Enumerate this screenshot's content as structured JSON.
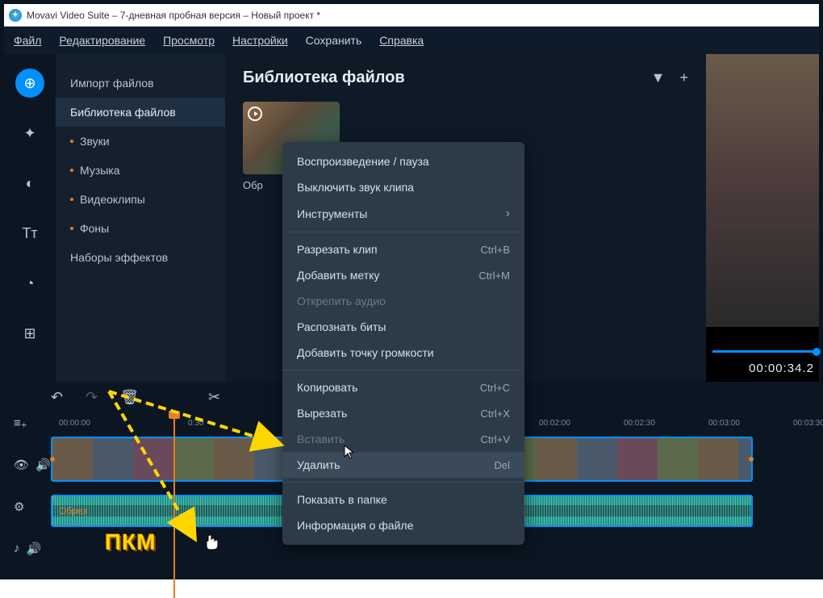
{
  "titlebar": {
    "title": "Movavi Video Suite – 7-дневная пробная версия – Новый проект *"
  },
  "menubar": [
    "Файл",
    "Редактирование",
    "Просмотр",
    "Настройки",
    "Сохранить",
    "Справка"
  ],
  "sidebar": {
    "items": [
      {
        "label": "Импорт файлов"
      },
      {
        "label": "Библиотека файлов"
      },
      {
        "label": "Звуки"
      },
      {
        "label": "Музыка"
      },
      {
        "label": "Видеоклипы"
      },
      {
        "label": "Фоны"
      },
      {
        "label": "Наборы эффектов"
      }
    ]
  },
  "content": {
    "title": "Библиотека файлов",
    "thumb_label": "Обр"
  },
  "preview": {
    "time": "00:00:34.2"
  },
  "context_menu": [
    {
      "label": "Воспроизведение / пауза",
      "shortcut": "",
      "type": "item"
    },
    {
      "label": "Выключить звук клипа",
      "shortcut": "",
      "type": "item"
    },
    {
      "label": "Инструменты",
      "shortcut": "",
      "type": "submenu"
    },
    {
      "type": "sep"
    },
    {
      "label": "Разрезать клип",
      "shortcut": "Ctrl+B",
      "type": "item"
    },
    {
      "label": "Добавить метку",
      "shortcut": "Ctrl+M",
      "type": "item"
    },
    {
      "label": "Открепить аудио",
      "shortcut": "",
      "type": "disabled"
    },
    {
      "label": "Распознать биты",
      "shortcut": "",
      "type": "item"
    },
    {
      "label": "Добавить точку громкости",
      "shortcut": "",
      "type": "item"
    },
    {
      "type": "sep"
    },
    {
      "label": "Копировать",
      "shortcut": "Ctrl+C",
      "type": "item"
    },
    {
      "label": "Вырезать",
      "shortcut": "Ctrl+X",
      "type": "item"
    },
    {
      "label": "Вставить",
      "shortcut": "Ctrl+V",
      "type": "disabled"
    },
    {
      "label": "Удалить",
      "shortcut": "Del",
      "type": "item",
      "hover": true
    },
    {
      "type": "sep"
    },
    {
      "label": "Показать в папке",
      "shortcut": "",
      "type": "item"
    },
    {
      "label": "Информация о файле",
      "shortcut": "",
      "type": "item"
    }
  ],
  "timeline": {
    "ruler": [
      "00:00:00",
      "0:30",
      "00:02:00",
      "00:02:30",
      "00:03:00",
      "00:03:30"
    ],
    "audio_label": "Обрез"
  },
  "annotation": "ПКМ"
}
